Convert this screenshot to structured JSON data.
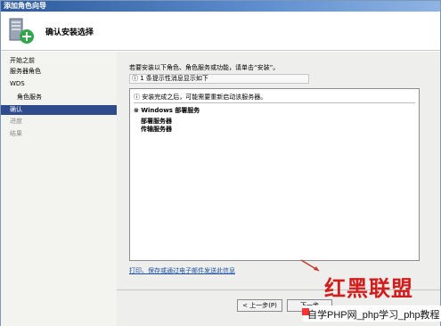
{
  "window": {
    "title": "添加角色向导"
  },
  "header": {
    "title": "确认安装选择",
    "icon": "server-add-icon"
  },
  "nav": {
    "items": [
      {
        "label": "开始之前",
        "state": "normal",
        "indent": false
      },
      {
        "label": "服务器角色",
        "state": "normal",
        "indent": false
      },
      {
        "label": "WDS",
        "state": "normal",
        "indent": false
      },
      {
        "label": "角色服务",
        "state": "normal",
        "indent": true
      },
      {
        "label": "确认",
        "state": "active",
        "indent": false
      },
      {
        "label": "进度",
        "state": "disabled",
        "indent": false
      },
      {
        "label": "结果",
        "state": "disabled",
        "indent": false
      }
    ]
  },
  "main": {
    "instruction": "若要安装以下角色、角色服务或功能，请单击“安装”。",
    "info_bar": "1 条提示性消息显示如下",
    "list": {
      "note": "安装完成之后，可能需要重新启动该服务器。",
      "group": "Windows 部署服务",
      "items": [
        "部署服务器",
        "传输服务器"
      ]
    },
    "link": "打印、保存或通过电子邮件发送此信息"
  },
  "buttons": {
    "prev": "< 上一步(P)",
    "next": "下一步"
  },
  "watermark": {
    "brand": "红黑联盟",
    "site": "自学PHP网_php学习_php教程"
  },
  "colors": {
    "active_nav": "#2e4b8b",
    "link": "#1d4ea5",
    "brand_red": "#d31d1d"
  }
}
